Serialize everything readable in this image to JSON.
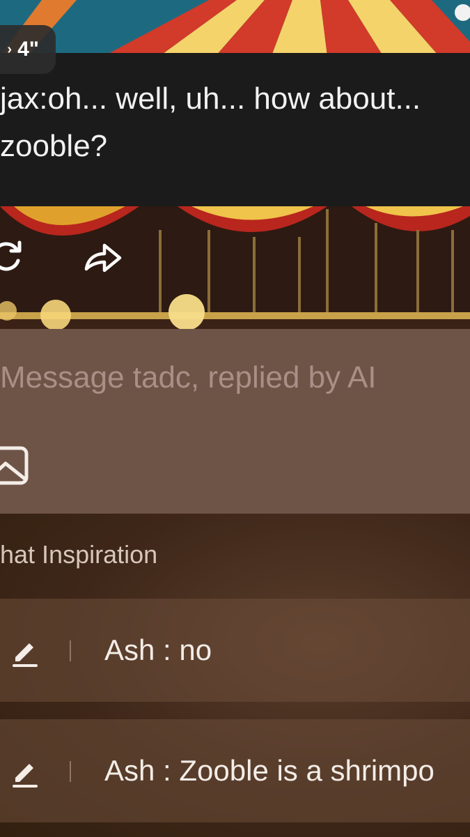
{
  "voice": {
    "duration": "4\"",
    "chevron": "›"
  },
  "message": {
    "line1": "jax:oh... well, uh... how about...",
    "line2": "zooble?"
  },
  "actions": {
    "regenerate_icon": "regenerate-icon",
    "share_icon": "share-icon"
  },
  "input": {
    "placeholder": "Message tadc, replied by AI",
    "value": "",
    "image_icon": "image-icon"
  },
  "inspiration": {
    "title": "hat Inspiration",
    "suggestions": [
      {
        "text": "Ash : no"
      },
      {
        "text": "Ash : Zooble is a shrimpo"
      }
    ]
  },
  "colors": {
    "message_bg": "#1b1b1b",
    "input_bg": "#6e5447",
    "inspiration_bg": "#3e2719",
    "placeholder": "#a89087"
  }
}
